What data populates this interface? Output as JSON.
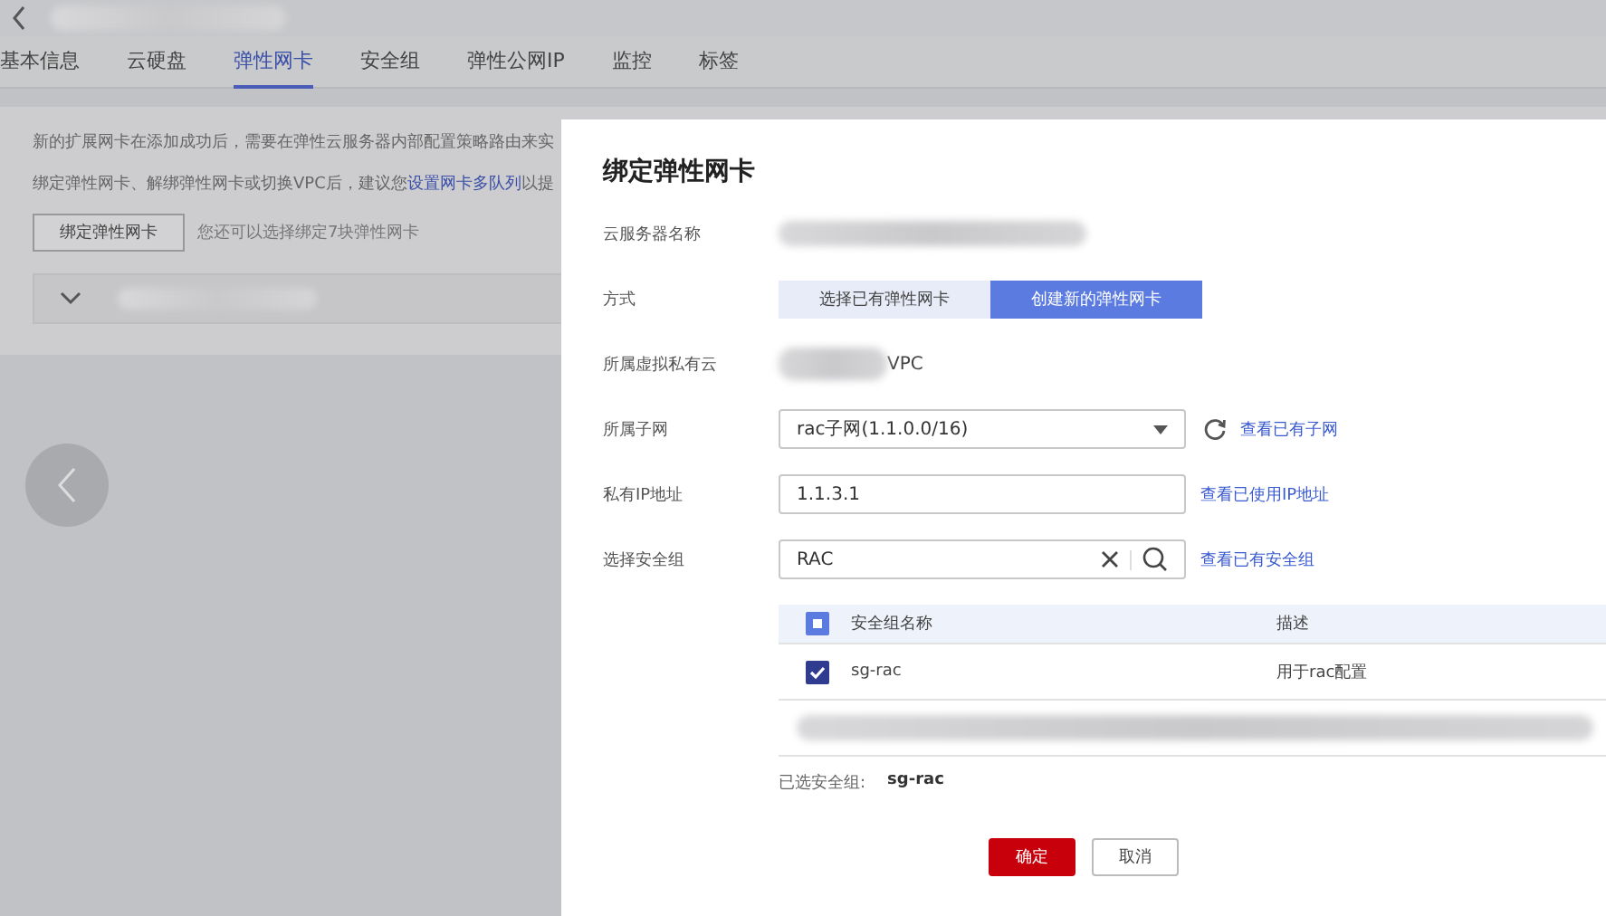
{
  "page": {
    "tabs": [
      {
        "label": "基本信息",
        "selected": false
      },
      {
        "label": "云硬盘",
        "selected": false
      },
      {
        "label": "弹性网卡",
        "selected": true
      },
      {
        "label": "安全组",
        "selected": false
      },
      {
        "label": "弹性公网IP",
        "selected": false
      },
      {
        "label": "监控",
        "selected": false
      },
      {
        "label": "标签",
        "selected": false
      }
    ],
    "notice_1": "新的扩展网卡在添加成功后，需要在弹性云服务器内部配置策略路由来实",
    "notice_2": {
      "before": "绑定弹性网卡、解绑弹性网卡或切换VPC后，建议您",
      "link": "设置网卡多队列",
      "after": "以提"
    },
    "bind_button": "绑定弹性网卡",
    "bind_hint": "您还可以选择绑定7块弹性网卡"
  },
  "dialog": {
    "title": "绑定弹性网卡",
    "fields": [
      {
        "kind": "redacted",
        "label": "云服务器名称"
      },
      {
        "kind": "toggle",
        "label": "方式",
        "options": [
          {
            "label": "选择已有弹性网卡",
            "selected": false
          },
          {
            "label": "创建新的弹性网卡",
            "selected": true
          }
        ]
      },
      {
        "kind": "text",
        "label": "所属虚拟私有云",
        "value": "VPC"
      },
      {
        "kind": "select",
        "label": "所属子网",
        "value": "rac子网(1.1.0.0/16)",
        "link": "查看已有子网"
      },
      {
        "kind": "input",
        "label": "私有IP地址",
        "value": "1.1.3.1",
        "link": "查看已使用IP地址"
      },
      {
        "kind": "search",
        "label": "选择安全组",
        "value": "RAC",
        "link": "查看已有安全组"
      }
    ],
    "table": {
      "columns": [
        "安全组名称",
        "描述"
      ],
      "header_partial": true,
      "rows": [
        {
          "kind": "item",
          "name": "sg-rac",
          "description": "用于rac配置",
          "checked": true
        },
        {
          "kind": "redacted"
        }
      ]
    },
    "selected_label": "已选安全组:",
    "selected_value": "sg-rac",
    "buttons": [
      {
        "label": "确定",
        "primary": true
      },
      {
        "label": "取消",
        "primary": false
      }
    ]
  }
}
